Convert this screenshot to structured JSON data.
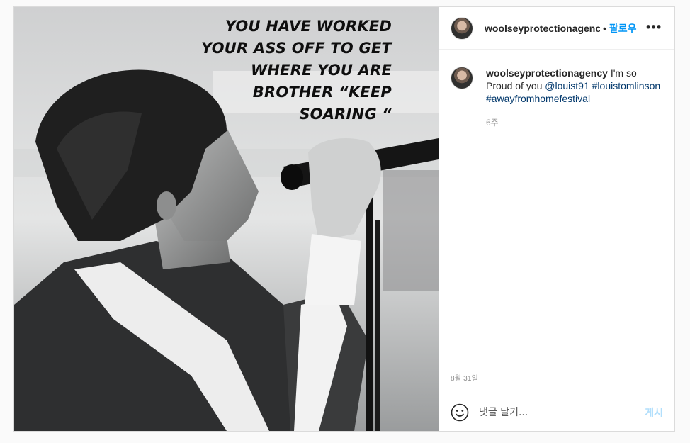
{
  "post": {
    "image": {
      "quote_lines": [
        "YOU HAVE WORKED",
        "YOUR ASS OFF TO GET",
        "WHERE YOU ARE",
        "BROTHER “KEEP",
        "SOARING “"
      ]
    },
    "header": {
      "username": "woolseyprotectionagency",
      "separator": "•",
      "follow_label": "팔로우",
      "more_icon": "more-horizontal-icon"
    },
    "caption": {
      "username": "woolseyprotectionagency",
      "text": "I'm so Proud of you",
      "mention": "@louist91",
      "hashtags": [
        "#louistomlinson",
        "#awayfromhomefestival"
      ],
      "time": "6주"
    },
    "date": "8월 31일",
    "comment": {
      "placeholder": "댓글 달기...",
      "post_label": "게시",
      "emoji_icon": "smiley-icon"
    },
    "colors": {
      "link_blue": "#0095f6",
      "post_disabled": "#b2dffc",
      "muted": "#8e8e8e"
    }
  }
}
